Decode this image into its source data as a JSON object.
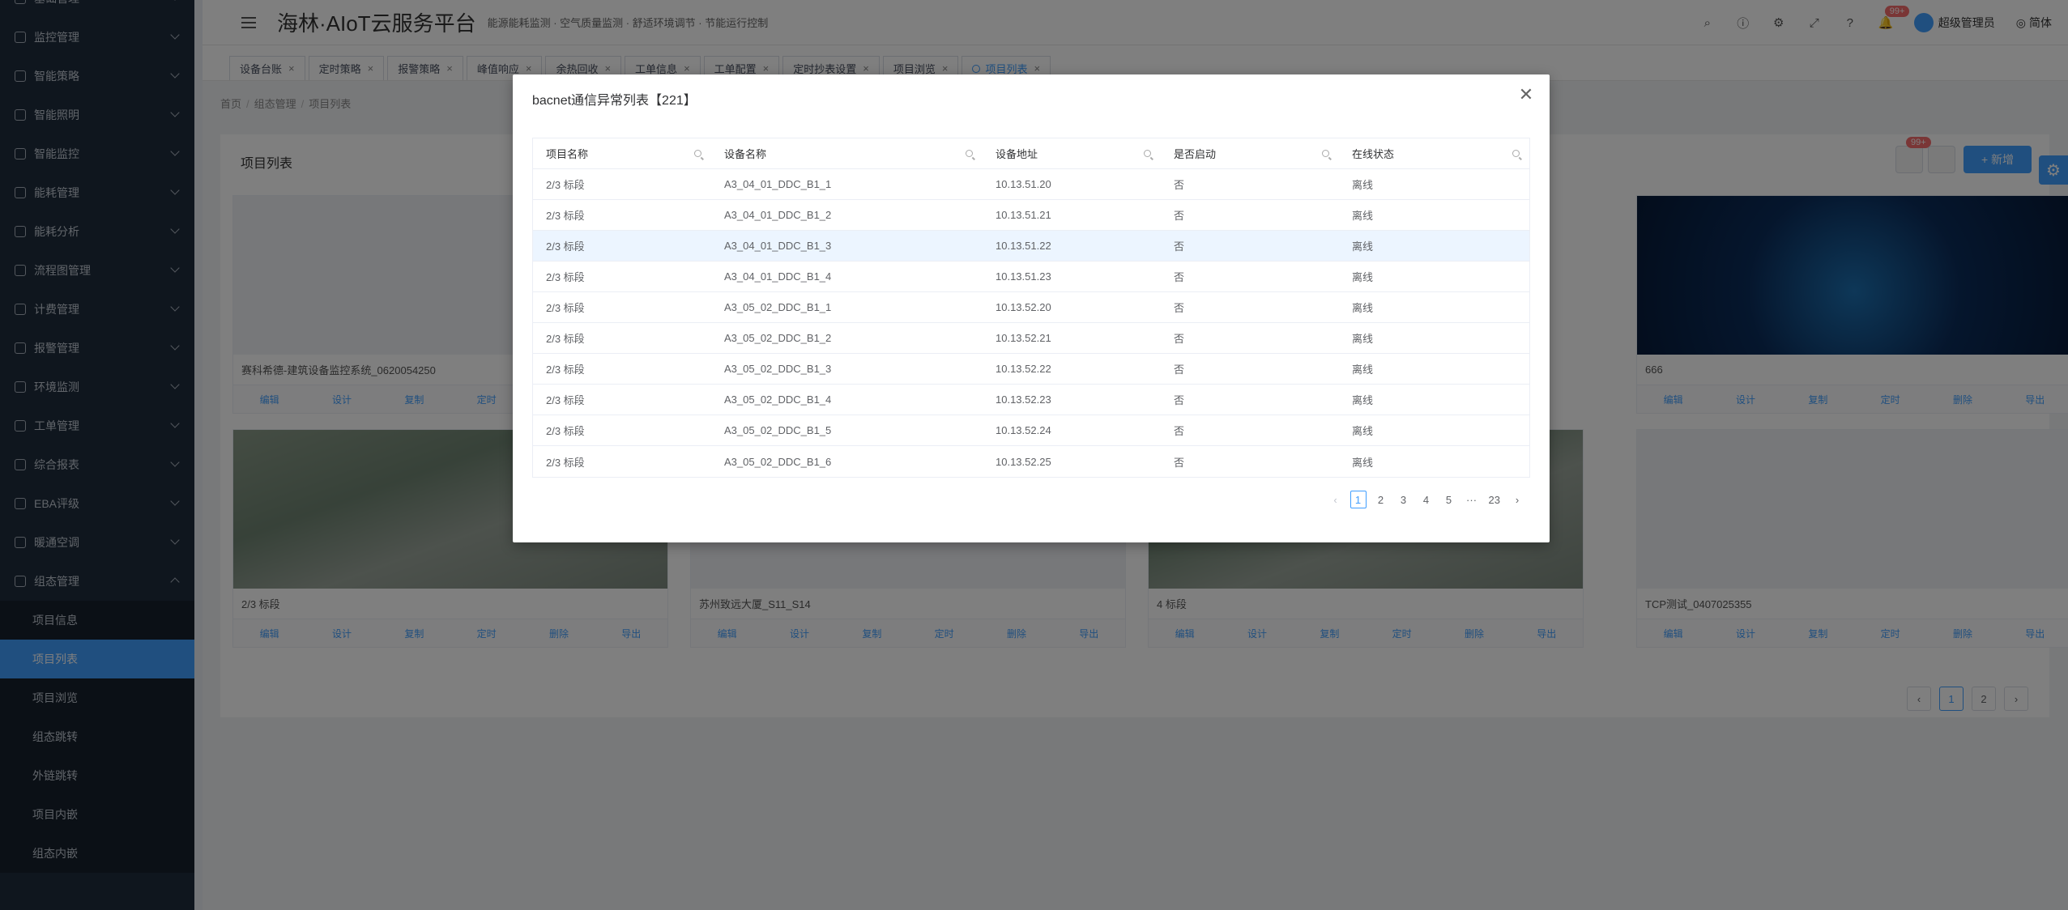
{
  "sidebar": {
    "items": [
      {
        "label": "基础管理"
      },
      {
        "label": "监控管理"
      },
      {
        "label": "智能策略"
      },
      {
        "label": "智能照明"
      },
      {
        "label": "智能监控"
      },
      {
        "label": "能耗管理"
      },
      {
        "label": "能耗分析"
      },
      {
        "label": "流程图管理"
      },
      {
        "label": "计费管理"
      },
      {
        "label": "报警管理"
      },
      {
        "label": "环境监测"
      },
      {
        "label": "工单管理"
      },
      {
        "label": "综合报表"
      },
      {
        "label": "EBA评级"
      },
      {
        "label": "暖通空调"
      },
      {
        "label": "组态管理"
      }
    ],
    "sub_items": [
      {
        "label": "项目信息"
      },
      {
        "label": "项目列表"
      },
      {
        "label": "项目浏览"
      },
      {
        "label": "组态跳转"
      },
      {
        "label": "外链跳转"
      },
      {
        "label": "项目内嵌"
      },
      {
        "label": "组态内嵌"
      }
    ]
  },
  "header": {
    "title": "海林·AIoT云服务平台",
    "subtitle": "能源能耗监测 · 空气质量监测 · 舒适环境调节 · 节能运行控制",
    "badge": "99+",
    "user": "超级管理员",
    "lang": "简体"
  },
  "tabs": [
    {
      "label": "设备台账"
    },
    {
      "label": "定时策略"
    },
    {
      "label": "报警策略"
    },
    {
      "label": "峰值响应"
    },
    {
      "label": "余热回收"
    },
    {
      "label": "工单信息"
    },
    {
      "label": "工单配置"
    },
    {
      "label": "定时抄表设置"
    },
    {
      "label": "项目浏览"
    },
    {
      "label": "项目列表"
    }
  ],
  "breadcrumb": [
    "首页",
    "组态管理",
    "项目列表"
  ],
  "panel": {
    "title": "项目列表",
    "badge": "99+",
    "new_label": "+ 新增"
  },
  "cards": [
    {
      "name": "赛科希德-建筑设备监控系统_0620054250",
      "img": "factory"
    },
    {
      "name": "666",
      "img": "dark"
    },
    {
      "name": "2/3 标段",
      "img": "city"
    },
    {
      "name": "苏州致远大厦_S11_S14",
      "img": "blue"
    },
    {
      "name": "4 标段",
      "img": "city"
    },
    {
      "name": "TCP测试_0407025355",
      "img": "factory"
    }
  ],
  "card_actions": [
    "编辑",
    "设计",
    "复制",
    "定时",
    "删除",
    "导出"
  ],
  "main_pager": {
    "pages": [
      "1",
      "2"
    ],
    "current": "1"
  },
  "modal": {
    "title": "bacnet通信异常列表【221】",
    "columns": [
      "项目名称",
      "设备名称",
      "设备地址",
      "是否启动",
      "在线状态"
    ],
    "rows": [
      [
        "2/3 标段",
        "A3_04_01_DDC_B1_1",
        "10.13.51.20",
        "否",
        "离线"
      ],
      [
        "2/3 标段",
        "A3_04_01_DDC_B1_2",
        "10.13.51.21",
        "否",
        "离线"
      ],
      [
        "2/3 标段",
        "A3_04_01_DDC_B1_3",
        "10.13.51.22",
        "否",
        "离线"
      ],
      [
        "2/3 标段",
        "A3_04_01_DDC_B1_4",
        "10.13.51.23",
        "否",
        "离线"
      ],
      [
        "2/3 标段",
        "A3_05_02_DDC_B1_1",
        "10.13.52.20",
        "否",
        "离线"
      ],
      [
        "2/3 标段",
        "A3_05_02_DDC_B1_2",
        "10.13.52.21",
        "否",
        "离线"
      ],
      [
        "2/3 标段",
        "A3_05_02_DDC_B1_3",
        "10.13.52.22",
        "否",
        "离线"
      ],
      [
        "2/3 标段",
        "A3_05_02_DDC_B1_4",
        "10.13.52.23",
        "否",
        "离线"
      ],
      [
        "2/3 标段",
        "A3_05_02_DDC_B1_5",
        "10.13.52.24",
        "否",
        "离线"
      ],
      [
        "2/3 标段",
        "A3_05_02_DDC_B1_6",
        "10.13.52.25",
        "否",
        "离线"
      ]
    ],
    "highlight_row": 2,
    "pager": {
      "pages": [
        "1",
        "2",
        "3",
        "4",
        "5",
        "···",
        "23"
      ],
      "current": "1"
    }
  }
}
